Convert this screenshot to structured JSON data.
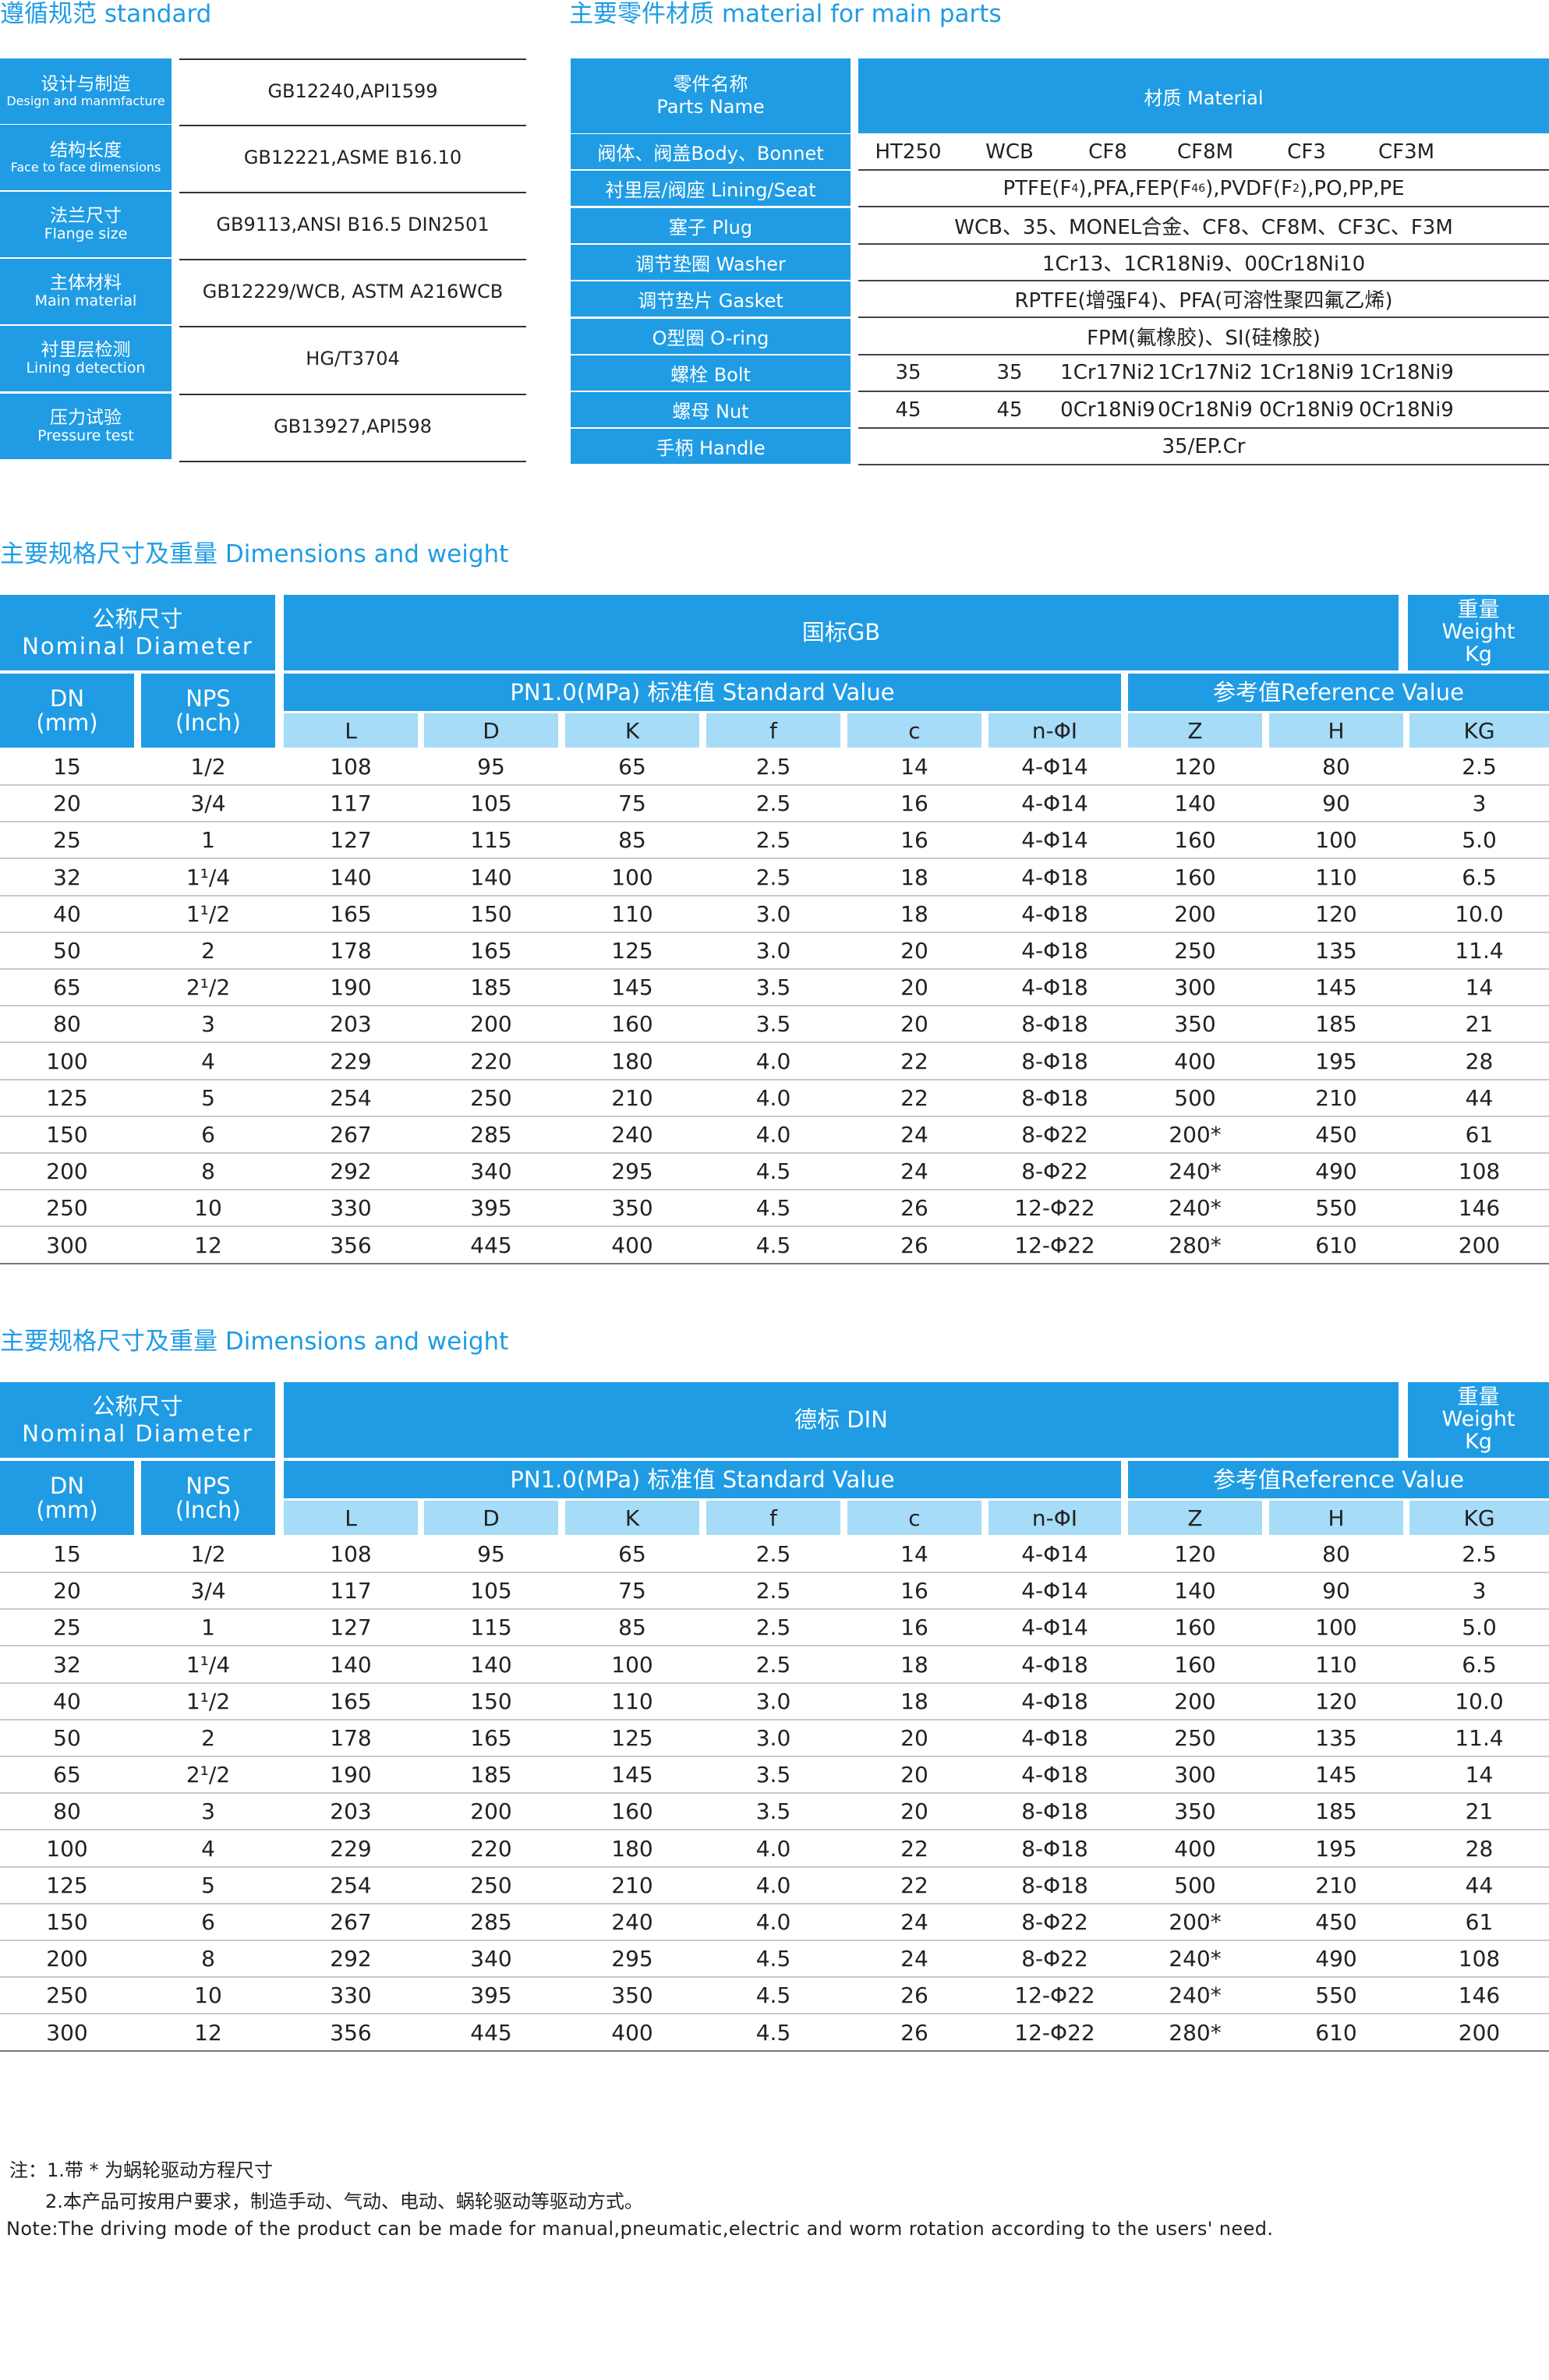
{
  "standard": {
    "title": "遵循规范  standard",
    "rows": [
      {
        "cn": "设计与制造",
        "en": "Design and manmfacture",
        "value": "GB12240,API1599"
      },
      {
        "cn": "结构长度",
        "en": "Face to face dimensions",
        "value": "GB12221,ASME B16.10"
      },
      {
        "cn": "法兰尺寸",
        "en": "Flange size",
        "value": "GB9113,ANSI B16.5  DIN2501"
      },
      {
        "cn": "主体材料",
        "en": "Main material",
        "value": "GB12229/WCB, ASTM A216WCB"
      },
      {
        "cn": "衬里层检测",
        "en": "Lining detection",
        "value": "HG/T3704"
      },
      {
        "cn": "压力试验",
        "en": "Pressure test",
        "value": "GB13927,API598"
      }
    ]
  },
  "materials": {
    "title": "主要零件材质  material for main parts",
    "header_name_cn": "零件名称",
    "header_name_en": "Parts Name",
    "header_material": "材质 Material",
    "rows": [
      {
        "label": "阀体、阀盖Body、Bonnet",
        "cells": [
          "HT250",
          "WCB",
          "CF8",
          "CF8M",
          "CF3",
          "CF3M"
        ]
      },
      {
        "label": "衬里层/阀座 Lining/Seat",
        "span": "PTFE(F4),PFA,FEP(F46),PVDF(F2),PO,PP,PE"
      },
      {
        "label": "塞子 Plug",
        "span": "WCB、35、MONEL合金、CF8、CF8M、CF3C、F3M"
      },
      {
        "label": "调节垫圈 Washer",
        "span": "1Cr13、1CR18Ni9、00Cr18Ni10"
      },
      {
        "label": "调节垫片 Gasket",
        "span": "RPTFE(增强F4)、PFA(可溶性聚四氟乙烯)"
      },
      {
        "label": "O型圈 O-ring",
        "span": "FPM(氟橡胶)、SI(硅橡胶)"
      },
      {
        "label": "螺栓 Bolt",
        "cells": [
          "35",
          "35",
          "1Cr17Ni2",
          "1Cr17Ni2",
          "1Cr18Ni9",
          "1Cr18Ni9"
        ]
      },
      {
        "label": "螺母 Nut",
        "cells": [
          "45",
          "45",
          "0Cr18Ni9",
          "0Cr18Ni9",
          "0Cr18Ni9",
          "0Cr18Ni9"
        ]
      },
      {
        "label": "手柄 Handle",
        "span": "35/EP.Cr"
      }
    ]
  },
  "dim_tables": [
    {
      "title": "主要规格尺寸及重量   Dimensions and weight",
      "nominal_cn": "公称尺寸",
      "nominal_en": "Nominal  Diameter",
      "standard_name": "国标GB",
      "weight_cn": "重量",
      "weight_en1": "Weight",
      "weight_en2": "Kg",
      "dn_label": "DN",
      "dn_unit": "(mm)",
      "nps_label": "NPS",
      "nps_unit": "(Inch)",
      "pn_label": "PN1.0(MPa) 标准值    Standard Value",
      "ref_label": "参考值Reference Value",
      "cols": [
        "L",
        "D",
        "K",
        "f",
        "c",
        "n-ΦI",
        "Z",
        "H",
        "KG"
      ],
      "rows": [
        [
          "15",
          "1/2",
          "108",
          "95",
          "65",
          "2.5",
          "14",
          "4-Φ14",
          "120",
          "80",
          "2.5"
        ],
        [
          "20",
          "3/4",
          "117",
          "105",
          "75",
          "2.5",
          "16",
          "4-Φ14",
          "140",
          "90",
          "3"
        ],
        [
          "25",
          "1",
          "127",
          "115",
          "85",
          "2.5",
          "16",
          "4-Φ14",
          "160",
          "100",
          "5.0"
        ],
        [
          "32",
          "1¹/4",
          "140",
          "140",
          "100",
          "2.5",
          "18",
          "4-Φ18",
          "160",
          "110",
          "6.5"
        ],
        [
          "40",
          "1¹/2",
          "165",
          "150",
          "110",
          "3.0",
          "18",
          "4-Φ18",
          "200",
          "120",
          "10.0"
        ],
        [
          "50",
          "2",
          "178",
          "165",
          "125",
          "3.0",
          "20",
          "4-Φ18",
          "250",
          "135",
          "11.4"
        ],
        [
          "65",
          "2¹/2",
          "190",
          "185",
          "145",
          "3.5",
          "20",
          "4-Φ18",
          "300",
          "145",
          "14"
        ],
        [
          "80",
          "3",
          "203",
          "200",
          "160",
          "3.5",
          "20",
          "8-Φ18",
          "350",
          "185",
          "21"
        ],
        [
          "100",
          "4",
          "229",
          "220",
          "180",
          "4.0",
          "22",
          "8-Φ18",
          "400",
          "195",
          "28"
        ],
        [
          "125",
          "5",
          "254",
          "250",
          "210",
          "4.0",
          "22",
          "8-Φ18",
          "500",
          "210",
          "44"
        ],
        [
          "150",
          "6",
          "267",
          "285",
          "240",
          "4.0",
          "24",
          "8-Φ22",
          "200*",
          "450",
          "61"
        ],
        [
          "200",
          "8",
          "292",
          "340",
          "295",
          "4.5",
          "24",
          "8-Φ22",
          "240*",
          "490",
          "108"
        ],
        [
          "250",
          "10",
          "330",
          "395",
          "350",
          "4.5",
          "26",
          "12-Φ22",
          "240*",
          "550",
          "146"
        ],
        [
          "300",
          "12",
          "356",
          "445",
          "400",
          "4.5",
          "26",
          "12-Φ22",
          "280*",
          "610",
          "200"
        ]
      ]
    },
    {
      "title": "主要规格尺寸及重量   Dimensions and weight",
      "nominal_cn": "公称尺寸",
      "nominal_en": "Nominal  Diameter",
      "standard_name": "德标 DIN",
      "weight_cn": "重量",
      "weight_en1": "Weight",
      "weight_en2": "Kg",
      "dn_label": "DN",
      "dn_unit": "(mm)",
      "nps_label": "NPS",
      "nps_unit": "(Inch)",
      "pn_label": "PN1.0(MPa) 标准值    Standard Value",
      "ref_label": "参考值Reference Value",
      "cols": [
        "L",
        "D",
        "K",
        "f",
        "c",
        "n-ΦI",
        "Z",
        "H",
        "KG"
      ],
      "rows": [
        [
          "15",
          "1/2",
          "108",
          "95",
          "65",
          "2.5",
          "14",
          "4-Φ14",
          "120",
          "80",
          "2.5"
        ],
        [
          "20",
          "3/4",
          "117",
          "105",
          "75",
          "2.5",
          "16",
          "4-Φ14",
          "140",
          "90",
          "3"
        ],
        [
          "25",
          "1",
          "127",
          "115",
          "85",
          "2.5",
          "16",
          "4-Φ14",
          "160",
          "100",
          "5.0"
        ],
        [
          "32",
          "1¹/4",
          "140",
          "140",
          "100",
          "2.5",
          "18",
          "4-Φ18",
          "160",
          "110",
          "6.5"
        ],
        [
          "40",
          "1¹/2",
          "165",
          "150",
          "110",
          "3.0",
          "18",
          "4-Φ18",
          "200",
          "120",
          "10.0"
        ],
        [
          "50",
          "2",
          "178",
          "165",
          "125",
          "3.0",
          "20",
          "4-Φ18",
          "250",
          "135",
          "11.4"
        ],
        [
          "65",
          "2¹/2",
          "190",
          "185",
          "145",
          "3.5",
          "20",
          "4-Φ18",
          "300",
          "145",
          "14"
        ],
        [
          "80",
          "3",
          "203",
          "200",
          "160",
          "3.5",
          "20",
          "8-Φ18",
          "350",
          "185",
          "21"
        ],
        [
          "100",
          "4",
          "229",
          "220",
          "180",
          "4.0",
          "22",
          "8-Φ18",
          "400",
          "195",
          "28"
        ],
        [
          "125",
          "5",
          "254",
          "250",
          "210",
          "4.0",
          "22",
          "8-Φ18",
          "500",
          "210",
          "44"
        ],
        [
          "150",
          "6",
          "267",
          "285",
          "240",
          "4.0",
          "24",
          "8-Φ22",
          "200*",
          "450",
          "61"
        ],
        [
          "200",
          "8",
          "292",
          "340",
          "295",
          "4.5",
          "24",
          "8-Φ22",
          "240*",
          "490",
          "108"
        ],
        [
          "250",
          "10",
          "330",
          "395",
          "350",
          "4.5",
          "26",
          "12-Φ22",
          "240*",
          "550",
          "146"
        ],
        [
          "300",
          "12",
          "356",
          "445",
          "400",
          "4.5",
          "26",
          "12-Φ22",
          "280*",
          "610",
          "200"
        ]
      ]
    }
  ],
  "notes": [
    "注：1.带 * 为蜗轮驱动方程尺寸",
    "2.本产品可按用户要求，制造手动、气动、电动、蜗轮驱动等驱动方式。",
    "Note:The driving mode of the product can be made for manual,pneumatic,electric and worm rotation according to the users' need."
  ]
}
